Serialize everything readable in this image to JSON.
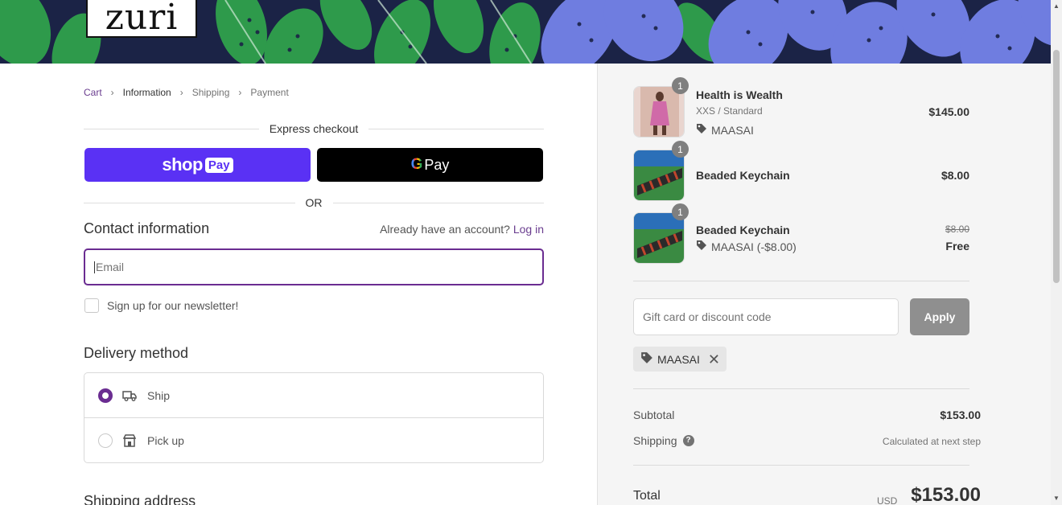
{
  "brand": {
    "logo_text": "zuri"
  },
  "breadcrumb": [
    {
      "label": "Cart",
      "state": "link"
    },
    {
      "label": "Information",
      "state": "active"
    },
    {
      "label": "Shipping",
      "state": "inactive"
    },
    {
      "label": "Payment",
      "state": "inactive"
    }
  ],
  "express": {
    "title": "Express checkout",
    "or_label": "OR",
    "shop_pay": {
      "word": "shop",
      "pill": "Pay"
    },
    "google_pay": {
      "g": "G",
      "word": "Pay"
    }
  },
  "contact": {
    "title": "Contact information",
    "account_prompt": "Already have an account?",
    "login_label": "Log in",
    "email_placeholder": "Email",
    "newsletter_label": "Sign up for our newsletter!"
  },
  "delivery": {
    "title": "Delivery method",
    "options": [
      {
        "label": "Ship",
        "icon": "truck-icon",
        "selected": true
      },
      {
        "label": "Pick up",
        "icon": "store-icon",
        "selected": false
      }
    ]
  },
  "shipping_address": {
    "title": "Shipping address"
  },
  "order": {
    "items": [
      {
        "name": "Health is Wealth",
        "variant": "XXS / Standard",
        "discount": "MAASAI",
        "price": "$145.00",
        "quantity": "1"
      },
      {
        "name": "Beaded Keychain",
        "price": "$8.00",
        "quantity": "1"
      },
      {
        "name": "Beaded Keychain",
        "discount": "MAASAI (-$8.00)",
        "price_old": "$8.00",
        "price": "Free",
        "quantity": "1"
      }
    ],
    "discount_placeholder": "Gift card or discount code",
    "apply_label": "Apply",
    "applied_code": "MAASAI",
    "subtotal_label": "Subtotal",
    "subtotal_value": "$153.00",
    "shipping_label": "Shipping",
    "shipping_note": "Calculated at next step",
    "total_label": "Total",
    "total_currency": "USD",
    "total_value": "$153.00"
  },
  "colors": {
    "accent": "#6a2c91",
    "shop_pay": "#5a31f4",
    "summary_bg": "#f5f5f5"
  }
}
